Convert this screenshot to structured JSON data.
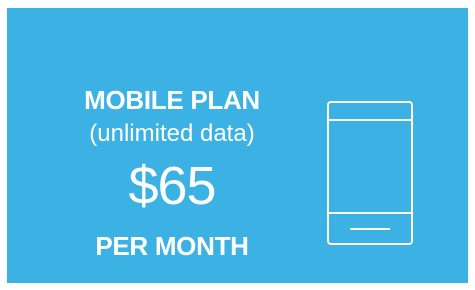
{
  "plan": {
    "title": "MOBILE PLAN",
    "subtitle": "(unlimited data)",
    "price": "$65",
    "period": "PER MONTH"
  },
  "colors": {
    "background": "#3cb1e3",
    "foreground": "#ffffff"
  },
  "icon": "smartphone-icon"
}
